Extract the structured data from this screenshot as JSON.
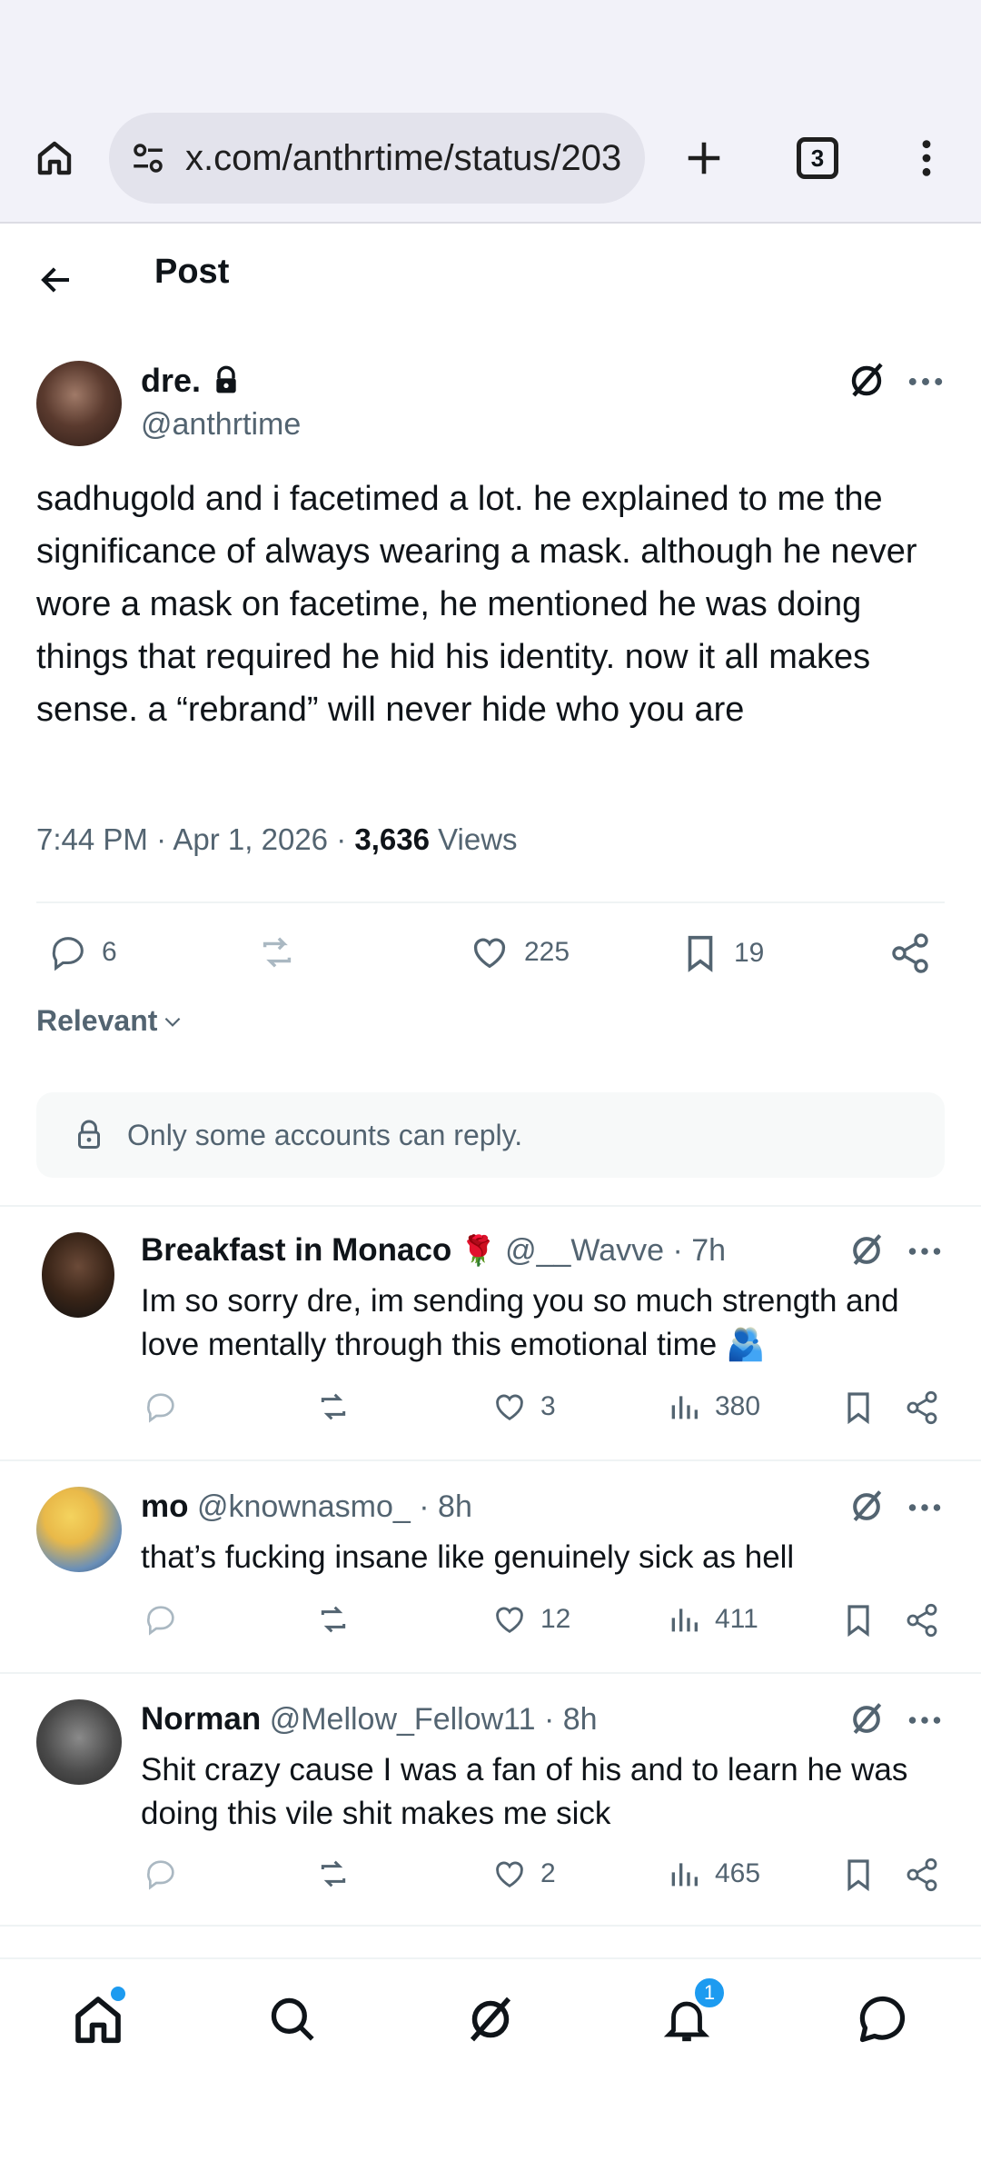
{
  "browser": {
    "url": "x.com/anthrtime/status/203",
    "tab_count": "3"
  },
  "header": {
    "title": "Post"
  },
  "tweet": {
    "name": "dre.",
    "handle": "@anthrtime",
    "text": "sadhugold and i facetimed a lot. he explained to me the significance of always wearing a mask. although he never wore a mask on facetime, he mentioned he was doing things that required he hid his identity. now it all makes sense. a “rebrand” will never hide who you are",
    "time": "7:44 PM · Apr 1, 2026 · ",
    "views_count": "3,636",
    "views_label": " Views",
    "replies": "6",
    "likes": "225",
    "bookmarks": "19"
  },
  "sort": {
    "label": "Relevant"
  },
  "reply_notice": "Only some accounts can reply.",
  "replies": [
    {
      "name": "Breakfast in Monaco",
      "name_emoji": "🌹",
      "handle": "@__Wavve",
      "time": "· 7h",
      "text": "Im so sorry dre, im sending you so much strength and love mentally through this emotional time",
      "text_emoji": "🫂",
      "likes": "3",
      "views": "380"
    },
    {
      "name": "mo",
      "handle": "@knownasmo_",
      "time": "· 8h",
      "text": "that’s fucking insane like genuinely sick as hell",
      "likes": "12",
      "views": "411"
    },
    {
      "name": "Norman",
      "handle": "@Mellow_Fellow11",
      "time": "· 8h",
      "text": "Shit crazy cause I was a fan of his and to learn he was doing this vile shit makes me sick",
      "likes": "2",
      "views": "465"
    }
  ],
  "nav": {
    "notification_count": "1"
  },
  "colors": {
    "accent": "#1d9bf0",
    "muted": "#536471",
    "text": "#0f1419"
  }
}
